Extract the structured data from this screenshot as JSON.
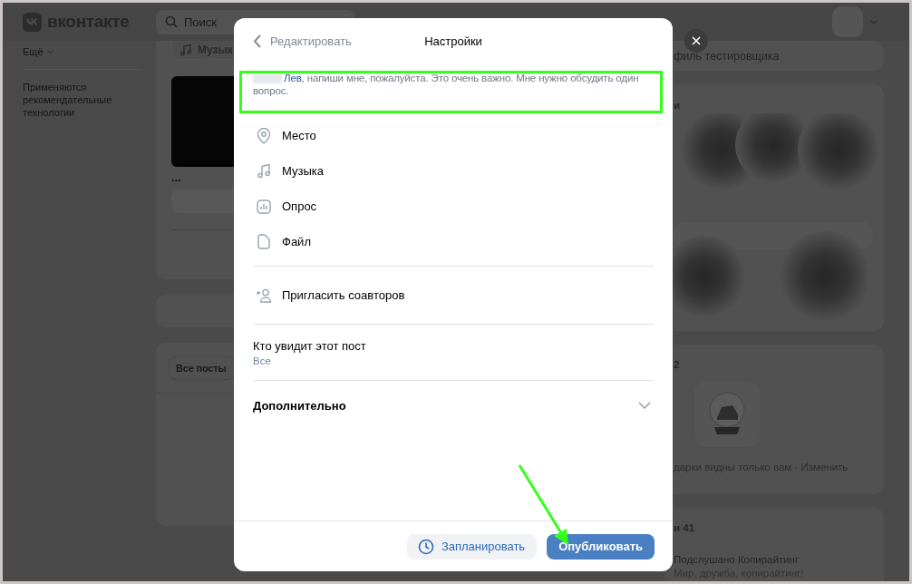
{
  "header": {
    "logo_text": "вконтакте",
    "search_placeholder": "Поиск"
  },
  "left_nav": {
    "more": "Ещё",
    "note": "Применяются рекомендательные технологии"
  },
  "feed": {
    "music_chip": "Музык",
    "ellipsis": "...",
    "filter": "Все посты"
  },
  "right_column": {
    "profile_link": "филь тестировщика",
    "friends_heading": "и",
    "gifts_count": "2",
    "gifts_note": "дарки видны только вам",
    "separator": "·",
    "gifts_edit": "Изменить",
    "subscriptions_heading": "и 41",
    "community_name": "Подслушано Копирайтинг",
    "community_status": "Мир, дружба, копирайтинг!"
  },
  "modal": {
    "back": "Редактировать",
    "title": "Настройки",
    "message": {
      "mention": "Лев",
      "text": ", напиши мне, пожалуйста. Это очень важно. Мне нужно обсудить один вопрос."
    },
    "attachments": [
      {
        "kind": "place",
        "label": "Место"
      },
      {
        "kind": "music",
        "label": "Музыка"
      },
      {
        "kind": "poll",
        "label": "Опрос"
      },
      {
        "kind": "file",
        "label": "Файл"
      }
    ],
    "coauthors": "Пригласить соавторов",
    "visibility": {
      "label": "Кто увидит этот пост",
      "value": "Все"
    },
    "more": {
      "label": "Дополнительно",
      "expanded": false
    },
    "buttons": {
      "schedule": "Запланировать",
      "publish": "Опубликовать"
    }
  }
}
